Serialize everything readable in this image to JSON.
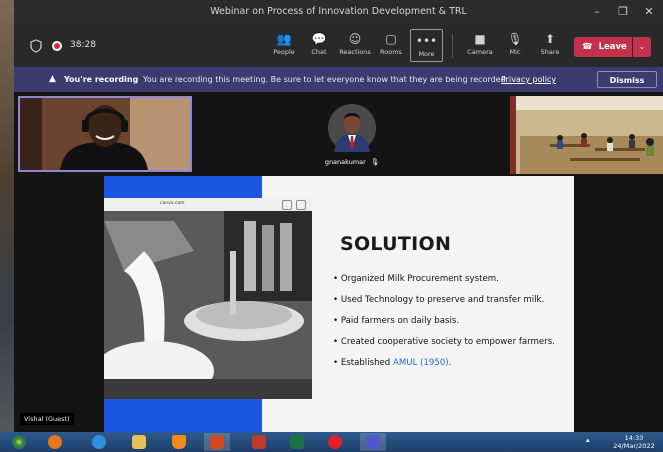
{
  "window": {
    "title": "Webinar on Process of Innovation Development & TRL",
    "controls": {
      "minimize": "–",
      "maximize": "❐",
      "close": "✕"
    }
  },
  "toolbar": {
    "timer": "38:28",
    "items": [
      {
        "label": "People",
        "icon": "people-icon",
        "glyph": "👥"
      },
      {
        "label": "Chat",
        "icon": "chat-icon",
        "glyph": "💬"
      },
      {
        "label": "Reactions",
        "icon": "reactions-icon",
        "glyph": "☺"
      },
      {
        "label": "Rooms",
        "icon": "rooms-icon",
        "glyph": "▢"
      },
      {
        "label": "More",
        "icon": "more-icon",
        "glyph": "•••"
      },
      {
        "label": "Camera",
        "icon": "camera-icon",
        "glyph": "■"
      },
      {
        "label": "Mic",
        "icon": "mic-off-icon",
        "glyph": "🎙"
      },
      {
        "label": "Share",
        "icon": "share-icon",
        "glyph": "⬆"
      }
    ],
    "leave_label": "Leave",
    "leave_color": "#c4314b"
  },
  "recording": {
    "title": "You're recording",
    "message": "You are recording this meeting. Be sure to let everyone know that they are being recorded.",
    "link": "Privacy policy",
    "dismiss": "Dismiss"
  },
  "participants": {
    "center_name": "gnanakumar",
    "guest_label": "Vishal (Guest)"
  },
  "slide": {
    "title": "SOLUTION",
    "browser_url": "canva.com",
    "accent_color": "#1a56e0",
    "bullets": [
      {
        "text": "Organized Milk Procurement system."
      },
      {
        "text": "Used Technology to preserve and transfer milk."
      },
      {
        "text": "Paid farmers on daily basis."
      },
      {
        "text": "Created cooperative society to empower farmers."
      },
      {
        "text": "Established ",
        "highlight": "AMUL (1950)",
        "suffix": "."
      }
    ]
  },
  "taskbar": {
    "time": "14:33",
    "date": "24/Mar/2022",
    "apps": [
      "start-button",
      "firefox-icon",
      "edge-icon",
      "file-explorer-icon",
      "vlc-icon",
      "powerpoint-icon",
      "chart-app-icon",
      "excel-icon",
      "opera-icon",
      "teams-icon"
    ]
  }
}
